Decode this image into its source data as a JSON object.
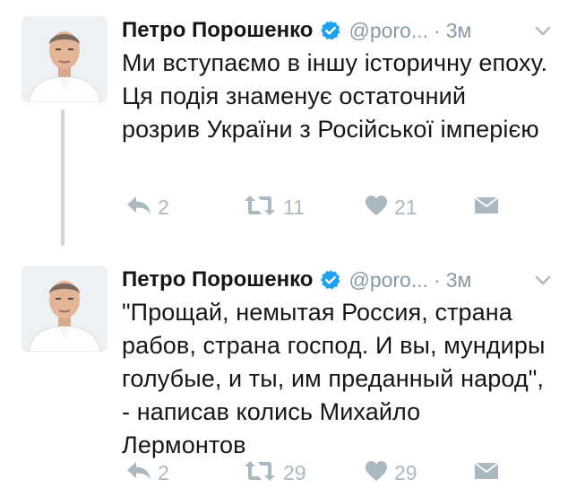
{
  "colors": {
    "text": "#14171a",
    "secondary": "#8899a6",
    "action": "#aab8c2",
    "verified": "#1da1f2",
    "thread_line": "#ccd6dd"
  },
  "tweets": [
    {
      "author": {
        "name": "Петро Порошенко",
        "handle": "@poro...",
        "verified": true
      },
      "separator": "·",
      "time": "3м",
      "text": "Ми вступаємо в іншу історичну епоху. Ця подія знаменує остаточний розрив України з Російської імперією",
      "stats": {
        "replies": "2",
        "retweets": "11",
        "likes": "21"
      },
      "icons": [
        "verified-icon",
        "chevron-down-icon",
        "reply-icon",
        "retweet-icon",
        "heart-icon",
        "envelope-icon"
      ]
    },
    {
      "author": {
        "name": "Петро Порошенко",
        "handle": "@poro...",
        "verified": true
      },
      "separator": "·",
      "time": "3м",
      "text": "\"Прощай, немытая Россия, страна рабов, страна господ. И вы, мундиры голубые, и ты, им преданный народ\", - написав колись Михайло Лермонтов",
      "stats": {
        "replies": "2",
        "retweets": "29",
        "likes": "29"
      },
      "icons": [
        "verified-icon",
        "chevron-down-icon",
        "reply-icon",
        "retweet-icon",
        "heart-icon",
        "envelope-icon"
      ]
    }
  ]
}
